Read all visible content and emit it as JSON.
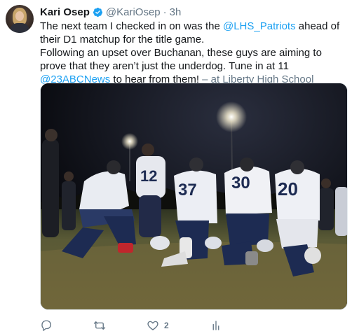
{
  "tweet": {
    "author_name": "Kari Osep",
    "author_handle": "@KariOsep",
    "separator": "·",
    "time": "3h",
    "line1_a": "The next team I checked in on was the ",
    "line1_link": "@LHS_Patriots",
    "line1_b": " ahead of their D1 matchup for the title game.",
    "line2_a": "Following an upset over Buchanan, these guys are aiming to prove that they aren’t just the underdog. Tune in at 11 ",
    "line2_link": "@23ABCNews",
    "line2_b": " to hear from them!",
    "location": " – at Liberty High School"
  },
  "photo": {
    "jersey_numbers": [
      "12",
      "37",
      "30",
      "20"
    ]
  },
  "actions": {
    "reply_icon": "reply-icon",
    "retweet_icon": "retweet-icon",
    "like_icon": "heart-icon",
    "like_count": "2",
    "analytics_icon": "analytics-icon"
  },
  "colors": {
    "link": "#1da1f2",
    "secondary": "#657786",
    "text": "#14171a",
    "verified": "#1da1f2"
  }
}
